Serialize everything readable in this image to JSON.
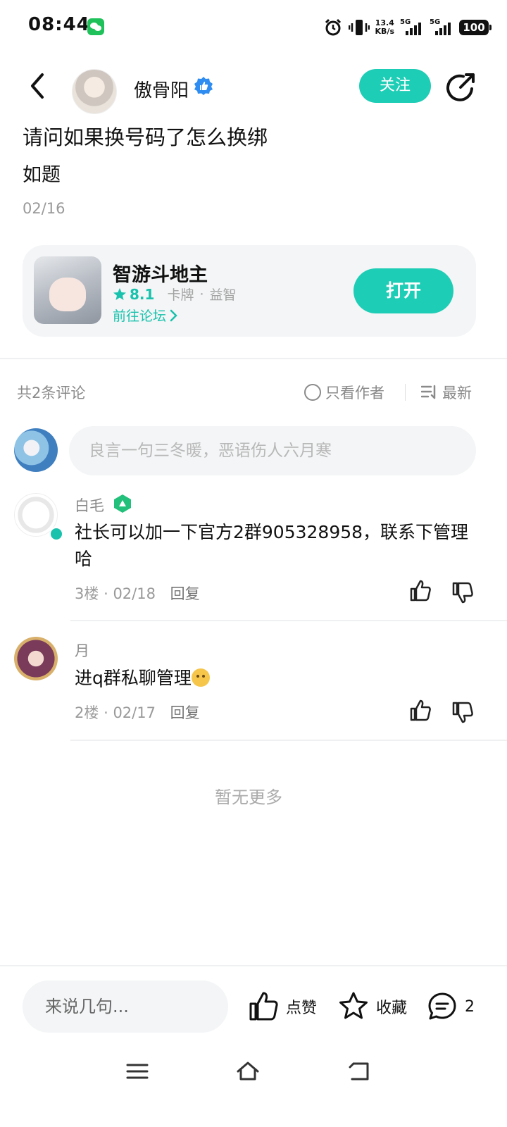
{
  "status_bar": {
    "time": "08:44",
    "speed_value": "13.4",
    "speed_unit": "KB/s",
    "network1": "5G",
    "network2": "5G",
    "battery": "100"
  },
  "header": {
    "author_name": "傲骨阳",
    "follow_label": "关注"
  },
  "post": {
    "title": "请问如果换号码了怎么换绑",
    "body": "如题",
    "date": "02/16"
  },
  "game_card": {
    "name": "智游斗地主",
    "rating": "8.1",
    "tag1": "卡牌",
    "separator": "·",
    "tag2": "益智",
    "forum_link": "前往论坛",
    "open_label": "打开"
  },
  "comments_header": {
    "count_label": "共2条评论",
    "author_only_label": "只看作者",
    "sort_label": "最新"
  },
  "comment_input_placeholder": "良言一句三冬暖，恶语伤人六月寒",
  "comments": [
    {
      "name": "白毛",
      "text": "社长可以加一下官方2群905328958，联系下管理哈",
      "floor": "3楼",
      "date": "02/18",
      "reply_label": "回复"
    },
    {
      "name": "月",
      "text": "进q群私聊管理",
      "floor": "2楼",
      "date": "02/17",
      "reply_label": "回复"
    }
  ],
  "meta_separator": "·",
  "no_more_label": "暂无更多",
  "bottom_bar": {
    "input_placeholder": "来说几句...",
    "like_label": "点赞",
    "favorite_label": "收藏",
    "comment_count": "2"
  },
  "colors": {
    "accent": "#1ecdb5",
    "text_primary": "#111111",
    "text_secondary": "#8a8a8a",
    "card_bg": "#f3f5f6"
  }
}
